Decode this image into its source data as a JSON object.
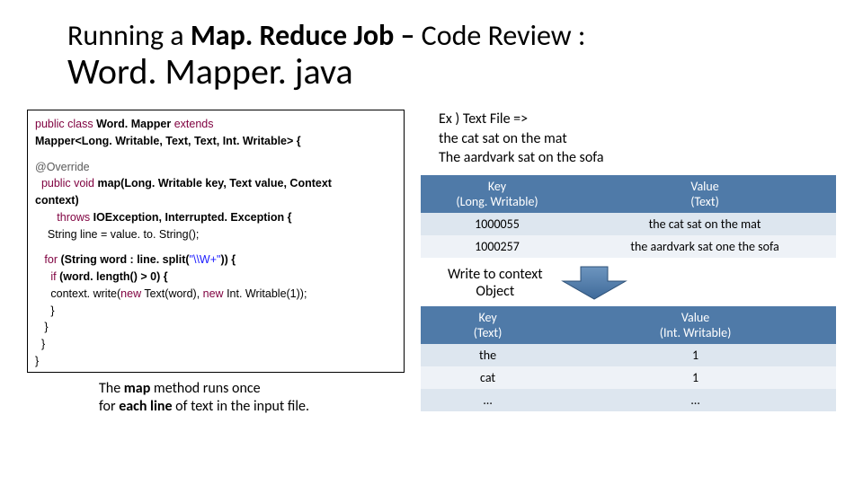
{
  "title": {
    "prefix": "Running a ",
    "bold": "Map. Reduce Job – ",
    "suffix": "Code Review :",
    "line2": "Word. Mapper. java"
  },
  "code": {
    "l1a": "public class ",
    "l1b": "Word. Mapper ",
    "l1c": "extends",
    "l2": "Mapper<Long. Writable, Text, Text, Int. Writable> {",
    "l3": "@Override",
    "l4a": "  public void ",
    "l4b": "map(Long. Writable key, Text value, Context",
    "l5": "context)",
    "l6a": "       throws ",
    "l6b": "IOException, Interrupted. Exception {",
    "l7": "    String line = value. to. String();",
    "l8a": "   for ",
    "l8b": "(String word : line. split(",
    "l8c": "\"\\\\W+\"",
    "l8d": ")) {",
    "l9a": "     if ",
    "l9b": "(word. length() > 0) {",
    "l10a": "     context. write(",
    "l10b": "new ",
    "l10c": "Text(word), ",
    "l10d": "new ",
    "l10e": "Int. Writable(1));",
    "l11": "     }",
    "l12": "   }",
    "l13": "  }",
    "l14": "}"
  },
  "footnote": {
    "p1": "The ",
    "b1": "map ",
    "p2": "method runs once",
    "p3": "for ",
    "b2": "each line ",
    "p4": "of text in the input file."
  },
  "example": {
    "l1": "Ex ) Text File =>",
    "l2": "the cat sat on the mat",
    "l3": "The aardvark sat on the sofa"
  },
  "table1": {
    "h1a": "Key",
    "h1b": "(Long. Writable)",
    "h2a": "Value",
    "h2b": "(Text)",
    "rows": [
      {
        "k": "1000055",
        "v": "the cat sat on the mat"
      },
      {
        "k": "1000257",
        "v": "the aardvark sat one the sofa"
      }
    ]
  },
  "write_label": {
    "l1": "Write to context",
    "l2": "Object"
  },
  "table2": {
    "h1a": "Key",
    "h1b": "(Text)",
    "h2a": "Value",
    "h2b": "(Int. Writable)",
    "rows": [
      {
        "k": "the",
        "v": "1"
      },
      {
        "k": "cat",
        "v": "1"
      },
      {
        "k": "…",
        "v": "…"
      }
    ]
  },
  "colors": {
    "header_bg": "#4f7aa8",
    "arrow_fill": "#4f7aa8"
  }
}
